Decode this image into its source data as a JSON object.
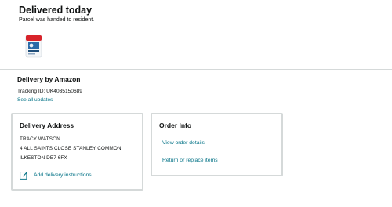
{
  "status": {
    "title": "Delivered today",
    "subtitle": "Parcel was handed to resident."
  },
  "product": {
    "image_icon": "product-box-image"
  },
  "delivery": {
    "heading": "Delivery by Amazon",
    "tracking": "Tracking ID: UK4035150689",
    "see_all_label": "See all updates"
  },
  "address_card": {
    "title": "Delivery Address",
    "lines": [
      "TRACY WATSON",
      "4 ALL SAINTS CLOSE STANLEY COMMON",
      "ILKESTON DE7 6FX"
    ],
    "instructions_label": "Add delivery instructions",
    "instructions_icon": "edit-icon"
  },
  "order_card": {
    "title": "Order Info",
    "links": [
      "View order details",
      "Return or replace items"
    ]
  },
  "colors": {
    "link": "#007185",
    "border": "#d5d9d9",
    "text": "#0f1111"
  }
}
